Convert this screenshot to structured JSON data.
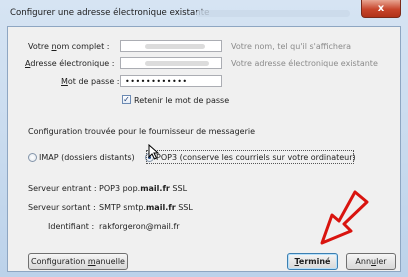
{
  "window": {
    "title": "Configurer une adresse électronique existante",
    "close_glyph": "x"
  },
  "form": {
    "name_label_pre": "Votre ",
    "name_label_accel": "n",
    "name_label_post": "om complet :",
    "name_hint": "Votre nom, tel qu'il s'affichera",
    "email_label_accel": "A",
    "email_label_post": "dresse électronique :",
    "email_hint": "Votre adresse électronique existante",
    "password_label_accel": "M",
    "password_label_post": "ot de passe :",
    "password_value": "••••••••••••",
    "remember_checked": true,
    "remember_label": "Retenir le mot de passe",
    "remember_check_glyph": "✓"
  },
  "config": {
    "found_text": "Configuration trouvée pour le fournisseur de messagerie",
    "imap_label": "IMAP (dossiers distants)",
    "pop3_label": "POP3 (conserve les courriels sur votre ordinateur)",
    "selected": "pop3"
  },
  "servers": {
    "incoming_label": "Serveur entrant :",
    "incoming_proto": "POP3",
    "incoming_host_pre": "pop.",
    "incoming_host_bold": "mail.fr",
    "incoming_sec": "SSL",
    "outgoing_label": "Serveur sortant :",
    "outgoing_proto": "SMTP",
    "outgoing_host_pre": "smtp.",
    "outgoing_host_bold": "mail.fr",
    "outgoing_sec": "SSL",
    "username_label": "Identifiant :",
    "username_value": "rakforgeron@mail.fr"
  },
  "buttons": {
    "manual_pre": "Configuration ",
    "manual_accel": "m",
    "manual_post": "anuelle",
    "done_accel": "T",
    "done_post": "erminé",
    "cancel_pre": "Ann",
    "cancel_accel": "u",
    "cancel_post": "ler"
  },
  "colors": {
    "annotation_arrow": "#d9140f",
    "titlebar": "#bcd2ea",
    "close_button": "#c7452b"
  }
}
